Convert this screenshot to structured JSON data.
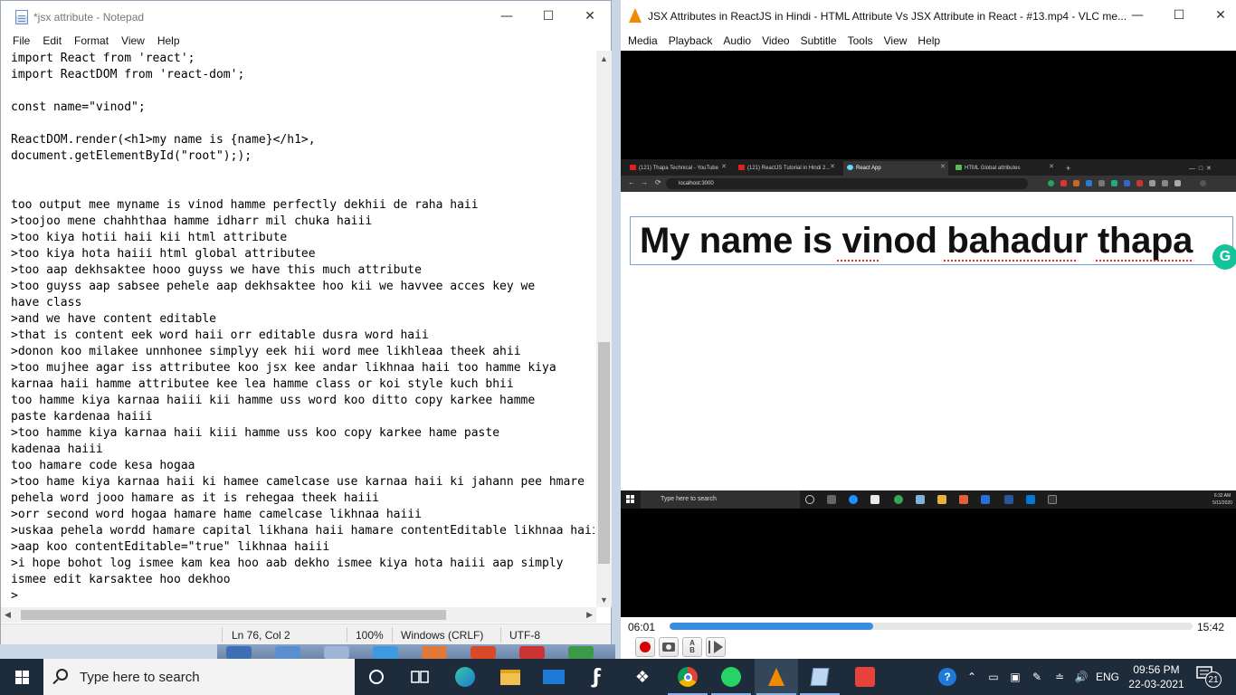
{
  "notepad": {
    "title": "*jsx attribute - Notepad",
    "menu": [
      "File",
      "Edit",
      "Format",
      "View",
      "Help"
    ],
    "lines": [
      "import React from 'react';",
      "import ReactDOM from 'react-dom';",
      "",
      "const name=\"vinod\";",
      "",
      "ReactDOM.render(<h1>my name is {name}</h1>,",
      "document.getElementById(\"root\"););",
      "",
      "",
      "too output mee myname is vinod hamme perfectly dekhii de raha haii",
      ">toojoo mene chahhthaa hamme idharr mil chuka haiii",
      ">too kiya hotii haii kii html attribute",
      ">too kiya hota haiii html global attributee",
      ">too aap dekhsaktee hooo guyss we have this much attribute",
      ">too guyss aap sabsee pehele aap dekhsaktee hoo kii we havvee acces key we",
      "have class",
      ">and we have content editable",
      ">that is content eek word haii orr editable dusra word haii",
      ">donon koo milakee unnhonee simplyy eek hii word mee likhleaa theek ahii",
      ">too mujhee agar iss attributee koo jsx kee andar likhnaa haii too hamme kiya",
      "karnaa haii hamme attributee kee lea hamme class or koi style kuch bhii",
      "too hamme kiya karnaa haiii kii hamme uss word koo ditto copy karkee hamme",
      "paste kardenaa haiii",
      ">too hamme kiya karnaa haii kiii hamme uss koo copy karkee hame paste",
      "kadenaa haiii",
      "too hamare code kesa hogaa",
      ">too hame kiya karnaa haii ki hamee camelcase use karnaa haii ki jahann pee hmare",
      "pehela word jooo hamare as it is rehegaa theek haiii",
      ">orr second word hogaa hamare hame camelcase likhnaa haiii",
      ">uskaa pehela wordd hamare capital likhana haii hamare contentEditable likhnaa haii",
      ">aap koo contentEditable=\"true\" likhnaa haiii",
      ">i hope bohot log ismee kam kea hoo aab dekho ismee kiya hota haiii aap simply",
      "ismee edit karsaktee hoo dekhoo",
      ">"
    ],
    "status": {
      "position": "Ln 76, Col 2",
      "zoom": "100%",
      "line_ending": "Windows (CRLF)",
      "encoding": "UTF-8"
    }
  },
  "vlc": {
    "title": "JSX Attributes in ReactJS in Hindi - HTML Attribute Vs JSX Attribute in React  - #13.mp4 - VLC me...",
    "menu": [
      "Media",
      "Playback",
      "Audio",
      "Video",
      "Subtitle",
      "Tools",
      "View",
      "Help"
    ],
    "time_elapsed": "06:01",
    "time_total": "15:42",
    "progress": 0.39,
    "video": {
      "tabs": [
        "(121) Thapa Technical - YouTube",
        "(121) ReactJS Tutorial in Hindi 2...",
        "React App",
        "HTML Global attributes"
      ],
      "url": "localhost:3000",
      "heading": "My name is vinod bahadur thapa",
      "taskbar_search": "Type here to search",
      "clock_time": "6:32 AM",
      "clock_date": "5/11/2020"
    }
  },
  "taskbar": {
    "search_placeholder": "Type here to search",
    "time": "09:56 PM",
    "date": "22-03-2021",
    "language": "ENG",
    "notifications": "21"
  },
  "colors": {
    "taskbar_bg": "#1e2b3a",
    "vlc_seek": "#3a8cde",
    "vlc_accent": "#f08a00",
    "grammarly": "#15c39a"
  }
}
